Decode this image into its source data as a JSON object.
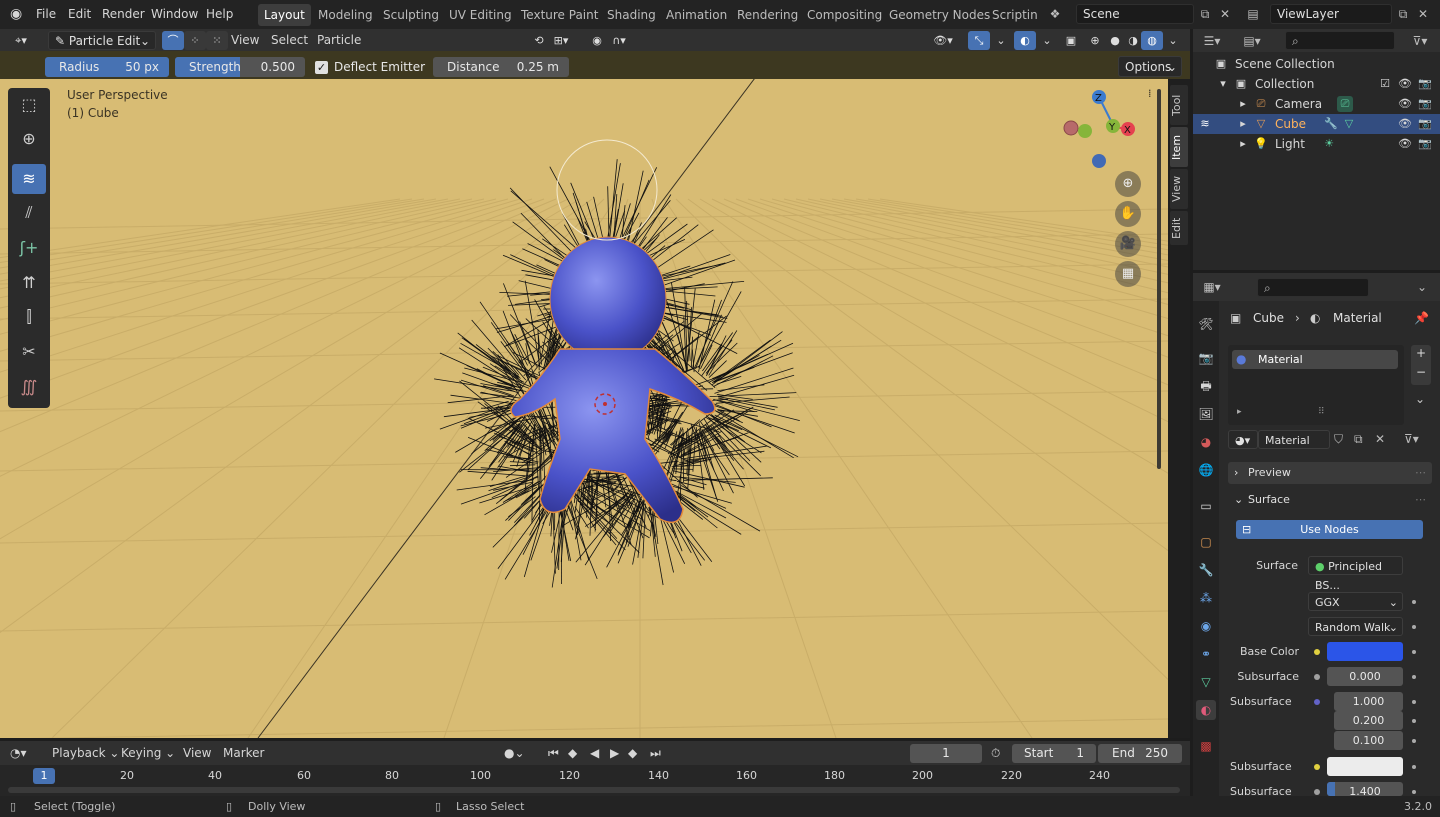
{
  "topbar": {
    "menus": [
      "File",
      "Edit",
      "Render",
      "Window",
      "Help"
    ],
    "workspaces": [
      "Layout",
      "Modeling",
      "Sculpting",
      "UV Editing",
      "Texture Paint",
      "Shading",
      "Animation",
      "Rendering",
      "Compositing",
      "Geometry Nodes",
      "Scripting"
    ],
    "active_workspace": "Layout",
    "scene": "Scene",
    "view_layer": "ViewLayer"
  },
  "viewport_header": {
    "mode": "Particle Edit",
    "menus": [
      "View",
      "Select",
      "Particle"
    ]
  },
  "tool_settings": {
    "radius_label": "Radius",
    "radius_value": "50 px",
    "strength_label": "Strength",
    "strength_value": "0.500",
    "deflect_label": "Deflect Emitter",
    "deflect_checked": true,
    "distance_label": "Distance",
    "distance_value": "0.25 m",
    "options_label": "Options"
  },
  "viewport": {
    "perspective": "User Perspective",
    "object_label": "(1) Cube",
    "background_color": "#d8bc74",
    "axis_colors": {
      "x": "#e5414f",
      "y": "#86b53a",
      "z": "#3b7bcf"
    },
    "gizmo_labels": {
      "x": "X",
      "y": "Y",
      "z": "Z"
    }
  },
  "npanel_tabs": [
    "Tool",
    "Item",
    "View",
    "Edit"
  ],
  "timeline": {
    "menus": [
      "Playback",
      "Keying",
      "View",
      "Marker"
    ],
    "current_frame": "1",
    "start_label": "Start",
    "start_value": "1",
    "end_label": "End",
    "end_value": "250",
    "frame_ticks": [
      "1",
      "20",
      "40",
      "60",
      "80",
      "100",
      "120",
      "140",
      "160",
      "180",
      "200",
      "220",
      "240"
    ]
  },
  "status_bar": {
    "select": "Select (Toggle)",
    "dolly": "Dolly View",
    "lasso": "Lasso Select",
    "version": "3.2.0"
  },
  "outliner": {
    "root": "Scene Collection",
    "collection": "Collection",
    "items": [
      {
        "name": "Camera",
        "icon": "camera-icon"
      },
      {
        "name": "Cube",
        "icon": "mesh-icon"
      },
      {
        "name": "Light",
        "icon": "light-icon"
      }
    ]
  },
  "properties": {
    "breadcrumb_object": "Cube",
    "breadcrumb_material": "Material",
    "slot_name": "Material",
    "material_name": "Material",
    "preview_label": "Preview",
    "surface_section": "Surface",
    "use_nodes": "Use Nodes",
    "surface_label": "Surface",
    "surface_shader": "Principled BS...",
    "distribution": "GGX",
    "subsurface_method": "Random Walk",
    "base_color_label": "Base Color",
    "base_color": "#2b55e8",
    "subsurface_label": "Subsurface",
    "subsurface_value": "0.000",
    "subsurface_radius_label": "Subsurface",
    "radius_1": "1.000",
    "radius_2": "0.200",
    "radius_3": "0.100",
    "subsurface_color_label": "Subsurface",
    "subsurface_ior_label": "Subsurface",
    "subsurface_ior_value": "1.400"
  }
}
